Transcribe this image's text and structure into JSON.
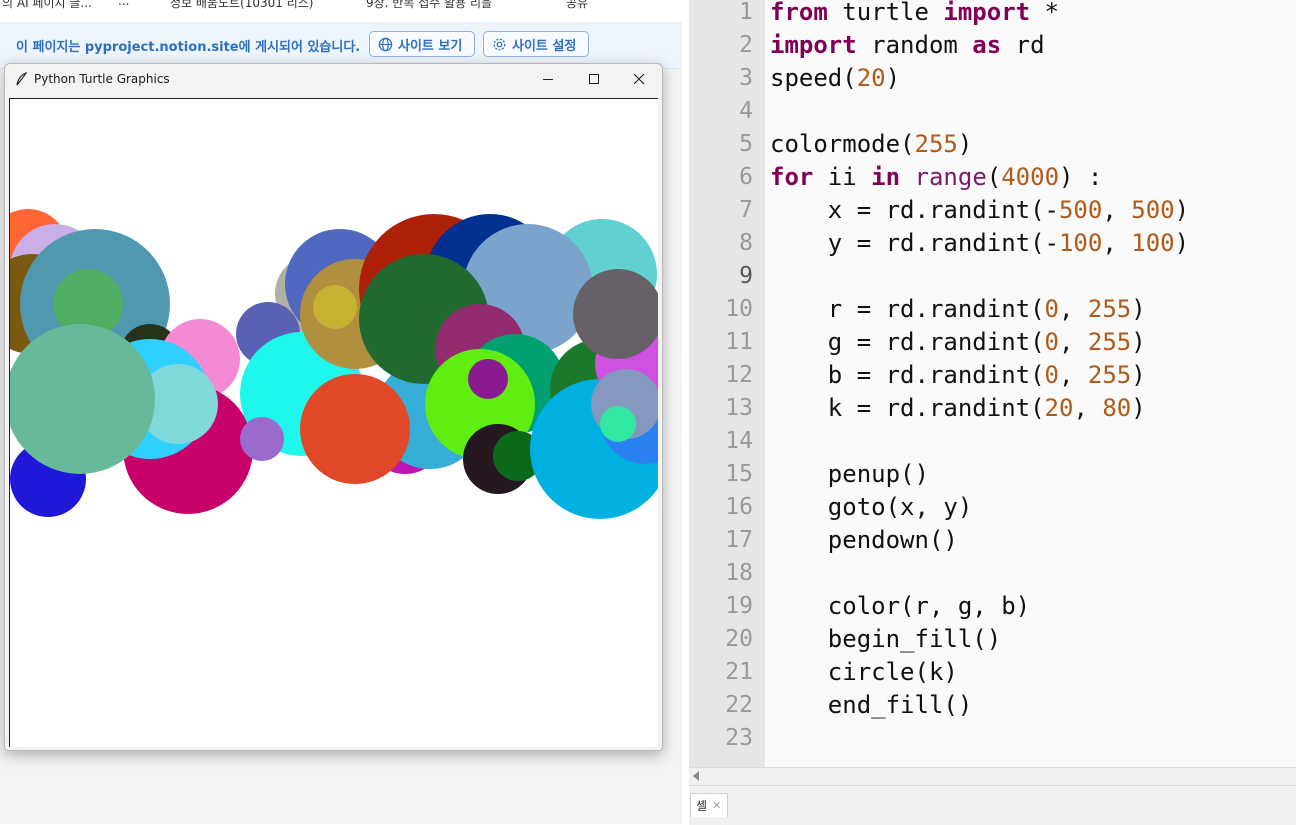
{
  "browser": {
    "bookmarks": [
      {
        "label": "의 AI 페이지 글..."
      },
      {
        "label": "..."
      },
      {
        "label": "정보 배움노트(10301 리스)"
      },
      {
        "label": "9장. 반복 접수 활용 리을"
      },
      {
        "label": "공유"
      }
    ],
    "notion_bar": {
      "message": "이 페이지는 pyproject.notion.site에 게시되어 있습니다.",
      "view_site_label": "사이트 보기",
      "site_settings_label": "사이트 설정"
    }
  },
  "turtle_window": {
    "title": "Python Turtle Graphics",
    "circles": [
      {
        "color": "#ff6633"
      },
      {
        "color": "#c9aee8"
      },
      {
        "color": "#28d74a"
      },
      {
        "color": "#7a5a12"
      },
      {
        "color": "#4f98b0"
      },
      {
        "color": "#4fae62"
      },
      {
        "color": "#26331a"
      },
      {
        "color": "#f58ad4"
      },
      {
        "color": "#1f18d8"
      },
      {
        "color": "#c8006a"
      },
      {
        "color": "#2ed0ff"
      },
      {
        "color": "#80d8d8"
      },
      {
        "color": "#66ba9a"
      },
      {
        "color": "#b0b0a4"
      },
      {
        "color": "#5a60b4"
      },
      {
        "color": "#5068c0"
      },
      {
        "color": "#1a1aa0"
      },
      {
        "color": "#c014b4"
      },
      {
        "color": "#1ef8ec"
      },
      {
        "color": "#9a6acc"
      },
      {
        "color": "#b0903e"
      },
      {
        "color": "#c8b030"
      },
      {
        "color": "#ae2008"
      },
      {
        "color": "#003090"
      },
      {
        "color": "#60d0d0"
      },
      {
        "color": "#7aa4cc"
      },
      {
        "color": "#36aed8"
      },
      {
        "color": "#e04828"
      },
      {
        "color": "#206a30"
      },
      {
        "color": "#922a6e"
      },
      {
        "color": "#00a070"
      },
      {
        "color": "#60ee10"
      },
      {
        "color": "#8a1a90"
      },
      {
        "color": "#261820"
      },
      {
        "color": "#0a6a1a"
      },
      {
        "color": "#1a7a2a"
      },
      {
        "color": "#00b0e0"
      },
      {
        "color": "#2a80f0"
      },
      {
        "color": "#d050e0"
      },
      {
        "color": "#666068"
      },
      {
        "color": "#8498c0"
      },
      {
        "color": "#30e8a0"
      }
    ]
  },
  "editor": {
    "lines": [
      {
        "num": "1",
        "parts": [
          {
            "t": "from",
            "c": "kw"
          },
          {
            "t": " turtle ",
            "c": ""
          },
          {
            "t": "import",
            "c": "kw"
          },
          {
            "t": " *",
            "c": ""
          }
        ]
      },
      {
        "num": "2",
        "parts": [
          {
            "t": "import",
            "c": "kw"
          },
          {
            "t": " random ",
            "c": ""
          },
          {
            "t": "as",
            "c": "kw"
          },
          {
            "t": " rd",
            "c": ""
          }
        ]
      },
      {
        "num": "3",
        "parts": [
          {
            "t": "speed(",
            "c": ""
          },
          {
            "t": "20",
            "c": "num"
          },
          {
            "t": ")",
            "c": ""
          }
        ]
      },
      {
        "num": "4",
        "parts": []
      },
      {
        "num": "5",
        "parts": [
          {
            "t": "colormode(",
            "c": ""
          },
          {
            "t": "255",
            "c": "num"
          },
          {
            "t": ")",
            "c": ""
          }
        ]
      },
      {
        "num": "6",
        "parts": [
          {
            "t": "for",
            "c": "kw"
          },
          {
            "t": " ii ",
            "c": ""
          },
          {
            "t": "in",
            "c": "kw"
          },
          {
            "t": " ",
            "c": ""
          },
          {
            "t": "range",
            "c": "bi"
          },
          {
            "t": "(",
            "c": ""
          },
          {
            "t": "4000",
            "c": "num"
          },
          {
            "t": ") :",
            "c": ""
          }
        ]
      },
      {
        "num": "7",
        "parts": [
          {
            "t": "    x = rd.randint(-",
            "c": ""
          },
          {
            "t": "500",
            "c": "num"
          },
          {
            "t": ", ",
            "c": ""
          },
          {
            "t": "500",
            "c": "num"
          },
          {
            "t": ")",
            "c": ""
          }
        ]
      },
      {
        "num": "8",
        "parts": [
          {
            "t": "    y = rd.randint(-",
            "c": ""
          },
          {
            "t": "100",
            "c": "num"
          },
          {
            "t": ", ",
            "c": ""
          },
          {
            "t": "100",
            "c": "num"
          },
          {
            "t": ")",
            "c": ""
          }
        ]
      },
      {
        "num": "9",
        "parts": []
      },
      {
        "num": "10",
        "parts": [
          {
            "t": "    r = rd.randint(",
            "c": ""
          },
          {
            "t": "0",
            "c": "num"
          },
          {
            "t": ", ",
            "c": ""
          },
          {
            "t": "255",
            "c": "num"
          },
          {
            "t": ")",
            "c": ""
          }
        ]
      },
      {
        "num": "11",
        "parts": [
          {
            "t": "    g = rd.randint(",
            "c": ""
          },
          {
            "t": "0",
            "c": "num"
          },
          {
            "t": ", ",
            "c": ""
          },
          {
            "t": "255",
            "c": "num"
          },
          {
            "t": ")",
            "c": ""
          }
        ]
      },
      {
        "num": "12",
        "parts": [
          {
            "t": "    b = rd.randint(",
            "c": ""
          },
          {
            "t": "0",
            "c": "num"
          },
          {
            "t": ", ",
            "c": ""
          },
          {
            "t": "255",
            "c": "num"
          },
          {
            "t": ")",
            "c": ""
          }
        ]
      },
      {
        "num": "13",
        "parts": [
          {
            "t": "    k = rd.randint(",
            "c": ""
          },
          {
            "t": "20",
            "c": "num"
          },
          {
            "t": ", ",
            "c": ""
          },
          {
            "t": "80",
            "c": "num"
          },
          {
            "t": ")",
            "c": ""
          }
        ]
      },
      {
        "num": "14",
        "parts": []
      },
      {
        "num": "15",
        "parts": [
          {
            "t": "    penup()",
            "c": ""
          }
        ]
      },
      {
        "num": "16",
        "parts": [
          {
            "t": "    goto(x, y)",
            "c": ""
          }
        ]
      },
      {
        "num": "17",
        "parts": [
          {
            "t": "    pendown()",
            "c": ""
          }
        ]
      },
      {
        "num": "18",
        "parts": []
      },
      {
        "num": "19",
        "parts": [
          {
            "t": "    color(r, g, b)",
            "c": ""
          }
        ]
      },
      {
        "num": "20",
        "parts": [
          {
            "t": "    begin_fill()",
            "c": ""
          }
        ]
      },
      {
        "num": "21",
        "parts": [
          {
            "t": "    circle(k)",
            "c": ""
          }
        ]
      },
      {
        "num": "22",
        "parts": [
          {
            "t": "    end_fill()",
            "c": ""
          }
        ]
      },
      {
        "num": "23",
        "parts": []
      }
    ],
    "current_line": "9",
    "shell_tab_label": "셸"
  }
}
